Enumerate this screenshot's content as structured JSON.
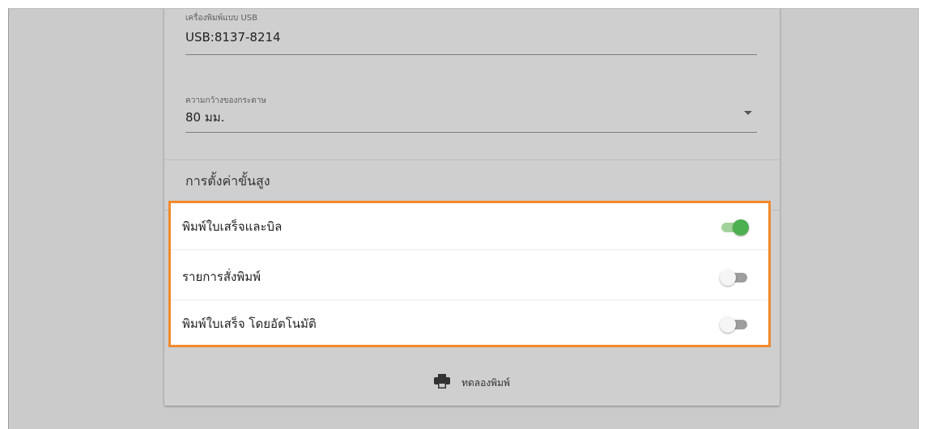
{
  "usb_printer": {
    "label": "เครื่องพิมพ์แบบ USB",
    "value": "USB:8137-8214"
  },
  "paper_width": {
    "label": "ความกว้างของกระดาษ",
    "value": "80 มม."
  },
  "advanced_settings": {
    "title": "การตั้งค่าขั้นสูง",
    "items": [
      {
        "label": "พิมพ์ใบเสร็จและบิล",
        "enabled": true
      },
      {
        "label": "รายการสั่งพิมพ์",
        "enabled": false
      },
      {
        "label": "พิมพ์ใบเสร็จ โดยอัตโนมัติ",
        "enabled": false
      }
    ]
  },
  "test_print": {
    "label": "ทดลองพิมพ์",
    "icon": "printer-icon"
  },
  "colors": {
    "highlight_border": "#f08a2c",
    "switch_on": "#4caf50",
    "overlay": "#cbcbcb"
  }
}
